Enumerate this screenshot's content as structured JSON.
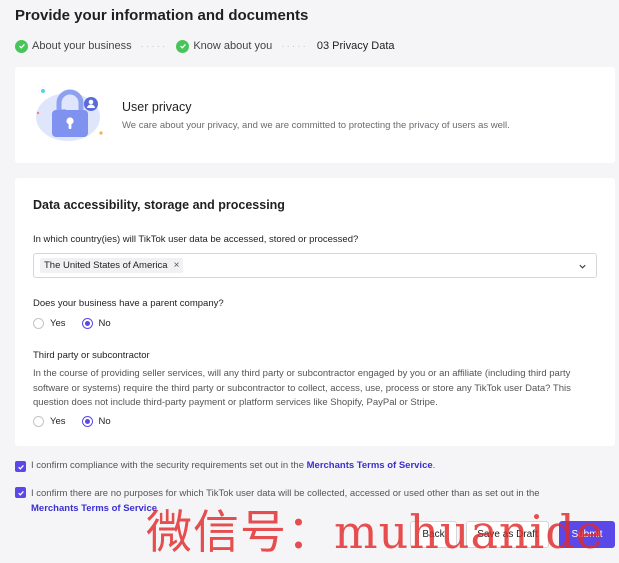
{
  "page": {
    "title": "Provide your information and documents"
  },
  "steps": [
    {
      "label": "About your business",
      "status": "done"
    },
    {
      "label": "Know about you",
      "status": "done"
    },
    {
      "label": "03 Privacy Data",
      "status": "current"
    }
  ],
  "privacy_card": {
    "title": "User privacy",
    "description": "We care about your privacy, and we are committed to protecting the privacy of users as well."
  },
  "data_section": {
    "title": "Data accessibility, storage and processing",
    "country_question": "In which country(ies) will TikTok user data be accessed, stored or processed?",
    "country_selected": "The United States of America",
    "tag_remove": "×",
    "parent_question": "Does your business have a parent company?",
    "parent_options": {
      "yes": "Yes",
      "no": "No",
      "selected": "No"
    },
    "third_party_question": "Third party or subcontractor",
    "third_party_description": "In the course of providing seller services, will any third party or subcontractor engaged by you or an affiliate (including third party software or systems) require the third party or subcontractor to collect, access, use, process or store any TikTok user Data? This question does not include third-party payment or platform services like Shopify, PayPal or Stripe.",
    "third_party_options": {
      "yes": "Yes",
      "no": "No",
      "selected": "No"
    }
  },
  "confirmations": {
    "c1_text": "I confirm compliance with the security requirements set out in the ",
    "c1_link": "Merchants Terms of Service",
    "c1_end": ".",
    "c1_checked": true,
    "c2_text": "I confirm there are no purposes for which TikTok user data will be collected, accessed or used other than as set out in the ",
    "c2_link": "Merchants Terms of Service",
    "c2_checked": true
  },
  "buttons": {
    "back": "Back",
    "draft": "Save as Draft",
    "submit": "Submit"
  },
  "watermark": "微信号：muhuanide",
  "colors": {
    "accent": "#5a48e8",
    "success": "#48c55a",
    "link": "#3a2fd0",
    "watermark": "#e22828"
  }
}
